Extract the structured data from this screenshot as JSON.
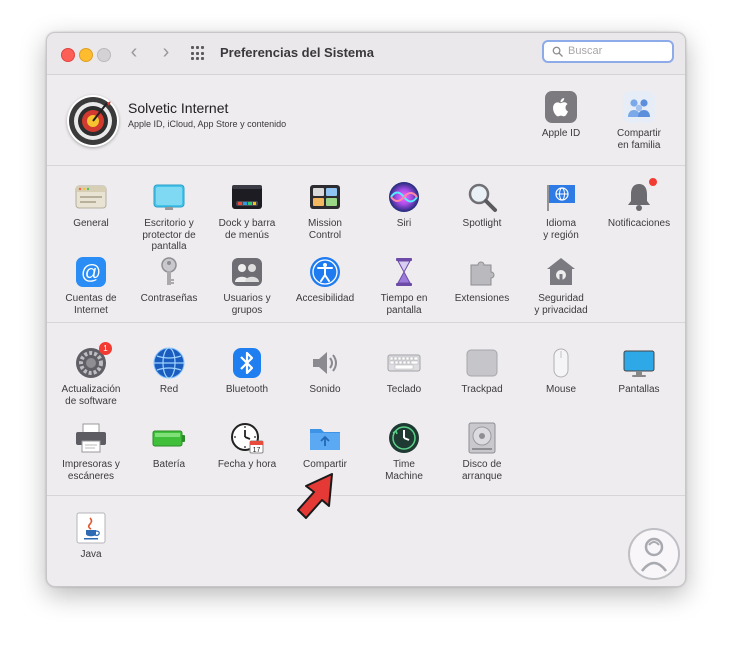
{
  "window": {
    "title": "Preferencias del Sistema"
  },
  "toolbar": {
    "back_glyph": "‹",
    "forward_glyph": "›",
    "search": {
      "placeholder": "Buscar",
      "value": ""
    }
  },
  "account": {
    "name": "Solvetic Internet",
    "subtitle": "Apple ID, iCloud, App Store y contenido",
    "items": [
      {
        "label": "Apple ID",
        "icon": "apple-id-icon"
      },
      {
        "label": "Compartir\nen familia",
        "icon": "family-sharing-icon"
      }
    ]
  },
  "sections": {
    "personal": [
      {
        "label": "General",
        "icon": "general-icon"
      },
      {
        "label": "Escritorio y\nprotector de pantalla",
        "icon": "desktop-screensaver-icon"
      },
      {
        "label": "Dock y barra\nde menús",
        "icon": "dock-menubar-icon"
      },
      {
        "label": "Mission\nControl",
        "icon": "mission-control-icon"
      },
      {
        "label": "Siri",
        "icon": "siri-icon"
      },
      {
        "label": "Spotlight",
        "icon": "spotlight-icon"
      },
      {
        "label": "Idioma\ny región",
        "icon": "language-region-icon"
      },
      {
        "label": "Notificaciones",
        "icon": "notifications-icon"
      },
      {
        "label": "Cuentas de\nInternet",
        "icon": "internet-accounts-icon"
      },
      {
        "label": "Contraseñas",
        "icon": "passwords-icon"
      },
      {
        "label": "Usuarios y\ngrupos",
        "icon": "users-groups-icon"
      },
      {
        "label": "Accesibilidad",
        "icon": "accessibility-icon"
      },
      {
        "label": "Tiempo en\npantalla",
        "icon": "screen-time-icon"
      },
      {
        "label": "Extensiones",
        "icon": "extensions-icon"
      },
      {
        "label": "Seguridad\ny privacidad",
        "icon": "security-privacy-icon"
      }
    ],
    "hardware": [
      {
        "label": "Actualización\nde software",
        "icon": "software-update-icon",
        "badge": "1"
      },
      {
        "label": "Red",
        "icon": "network-icon"
      },
      {
        "label": "Bluetooth",
        "icon": "bluetooth-icon"
      },
      {
        "label": "Sonido",
        "icon": "sound-icon"
      },
      {
        "label": "Teclado",
        "icon": "keyboard-icon"
      },
      {
        "label": "Trackpad",
        "icon": "trackpad-icon"
      },
      {
        "label": "Mouse",
        "icon": "mouse-icon"
      },
      {
        "label": "Pantallas",
        "icon": "displays-icon"
      },
      {
        "label": "Impresoras y\nescáneres",
        "icon": "printers-scanners-icon"
      },
      {
        "label": "Batería",
        "icon": "battery-icon"
      },
      {
        "label": "Fecha y hora",
        "icon": "date-time-icon",
        "calendar_day": "17"
      },
      {
        "label": "Compartir",
        "icon": "sharing-icon"
      },
      {
        "label": "Time\nMachine",
        "icon": "time-machine-icon"
      },
      {
        "label": "Disco de\narranque",
        "icon": "startup-disk-icon"
      }
    ],
    "other": [
      {
        "label": "Java",
        "icon": "java-icon"
      }
    ]
  },
  "colors": {
    "accent": "#3b82f6",
    "badge": "#f23b32",
    "annotation_arrow": "#e53935"
  }
}
